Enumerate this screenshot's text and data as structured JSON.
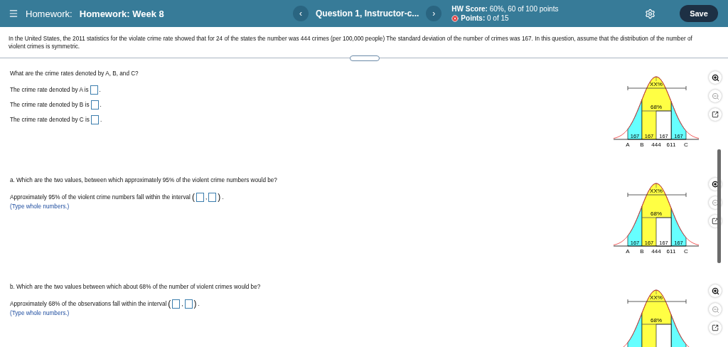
{
  "header": {
    "section_label": "Homework:",
    "title": "Homework: Week 8",
    "question": "Question 1, Instructor-c...",
    "prev": "‹",
    "next": "›",
    "score": "**HW Score:** 60%, 60 of 100 points",
    "points": "**Points:** 0 of 15",
    "save": "Save"
  },
  "problem": "In the United States, the 2011 statistics for the violate crime rate showed that for 24 of the states the number was 444 crimes (per 100,000 people) The standard deviation of the number of crimes was 167. In this question, assume that the distribution of the number of violent crimes is symmetric.",
  "sections": [
    {
      "question": "What are the crime rates denoted by A, B, and C?",
      "lines": [
        {
          "kind": "single",
          "text": "The crime rate denoted by A is",
          "end": "."
        },
        {
          "kind": "single",
          "text": "The crime rate denoted by B is",
          "end": "."
        },
        {
          "kind": "single",
          "text": "The crime rate denoted by C is",
          "end": "."
        }
      ],
      "graph": {
        "outer": "XX%",
        "inner": "68%",
        "segments": [
          "167",
          "167",
          "167",
          "167"
        ],
        "axis": [
          "A",
          "B",
          "444",
          "611",
          "C"
        ]
      }
    },
    {
      "question": "a. Which are the two values, between which approximately 95% of the violent crime numbers would be?",
      "lines": [
        {
          "kind": "interval",
          "text": "Approximately 95% of the violent crime numbers fall within the interval",
          "open": "(",
          "sep": ",",
          "close": ")",
          "end": "."
        }
      ],
      "hint": "(Type whole numbers.)",
      "graph": {
        "outer": "XX%",
        "inner": "68%",
        "segments": [
          "167",
          "167",
          "167",
          "167"
        ],
        "axis": [
          "A",
          "B",
          "444",
          "611",
          "C"
        ]
      }
    },
    {
      "question": "b. Which are the two values between which about 68% of the number of violent crimes would be?",
      "lines": [
        {
          "kind": "interval",
          "text": "Approximately 68% of the observations fall within the interval",
          "open": "(",
          "sep": ",",
          "close": ")",
          "end": "."
        }
      ],
      "hint": "(Type whole numbers.)",
      "graph": {
        "outer": "XX%",
        "inner": "68%"
      }
    }
  ]
}
